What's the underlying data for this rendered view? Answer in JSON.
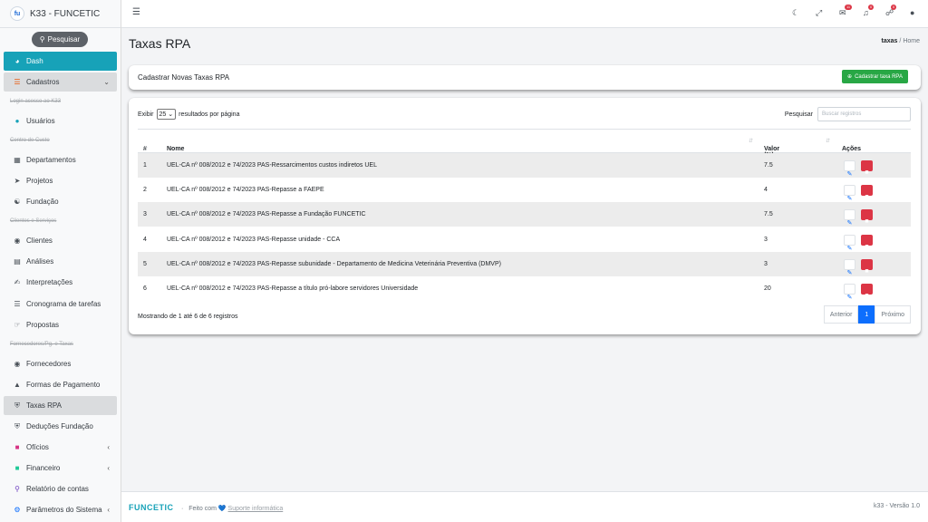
{
  "app": {
    "logo_text": "fu",
    "title": "K33 - FUNCETIC",
    "search_label": "Pesquisar"
  },
  "sidebar": {
    "dash": "Dash",
    "cadastros": "Cadastros",
    "hdr_access": "Login acesso ao K33",
    "usuarios": "Usuários",
    "hdr_cost": "Centro de Custo",
    "departamentos": "Departamentos",
    "projetos": "Projetos",
    "fundacao": "Fundação",
    "hdr_clients": "Clientes e Serviços",
    "clientes": "Clientes",
    "analises": "Análises",
    "interpretacoes": "Interpretações",
    "cronograma": "Cronograma de tarefas",
    "propostas": "Propostas",
    "hdr_suppliers": "Fornecedores/Pg. e Taxas",
    "fornecedores": "Fornecedores",
    "formas_pagamento": "Formas de Pagamento",
    "taxas_rpa": "Taxas RPA",
    "deducoes": "Deduções Fundação",
    "oficios": "Ofícios",
    "financeiro": "Financeiro",
    "relatorio": "Relatório de contas",
    "parametros": "Parâmetros do Sistema"
  },
  "topbar": {
    "badge_messages": "11",
    "badge_alerts": "0",
    "badge_tasks": "0"
  },
  "page": {
    "title": "Taxas RPA",
    "breadcrumb_current": "taxas",
    "breadcrumb_sep": "/",
    "breadcrumb_home": "Home"
  },
  "register_card": {
    "title": "Cadastrar Novas Taxas RPA",
    "button": "Cadastrar taxa RPA"
  },
  "table": {
    "show_label": "Exibir",
    "page_length": "25",
    "per_page_label": "resultados por página",
    "search_label": "Pesquisar",
    "search_placeholder": "Buscar registros",
    "columns": {
      "id": "#",
      "name": "Nome",
      "value": "Valor (%)",
      "actions": "Ações"
    },
    "rows": [
      {
        "id": "1",
        "name": "UEL-CA nº 008/2012 e 74/2023 PAS-Ressarcimentos custos indiretos UEL",
        "value": "7.5"
      },
      {
        "id": "2",
        "name": "UEL-CA nº 008/2012 e 74/2023 PAS-Repasse a FAEPE",
        "value": "4"
      },
      {
        "id": "3",
        "name": "UEL-CA nº 008/2012 e 74/2023 PAS-Repasse a Fundação FUNCETIC",
        "value": "7.5"
      },
      {
        "id": "4",
        "name": "UEL-CA nº 008/2012 e 74/2023 PAS-Repasse unidade - CCA",
        "value": "3"
      },
      {
        "id": "5",
        "name": "UEL-CA nº 008/2012 e 74/2023 PAS-Repasse subunidade - Departamento de Medicina Veterinária Preventiva (DMVP)",
        "value": "3"
      },
      {
        "id": "6",
        "name": "UEL-CA nº 008/2012 e 74/2023 PAS-Repasse a título pró-labore servidores Universidade",
        "value": "20"
      }
    ],
    "info": "Mostrando de 1 até 6 de 6 registros",
    "pager": {
      "prev": "Anterior",
      "current": "1",
      "next": "Próximo"
    }
  },
  "footer": {
    "brand": "FUNCETIC",
    "sep": "·",
    "made_with": "Feito com",
    "heart": "💙",
    "support": "Suporte informática",
    "version": "k33 - Versão 1.0"
  }
}
